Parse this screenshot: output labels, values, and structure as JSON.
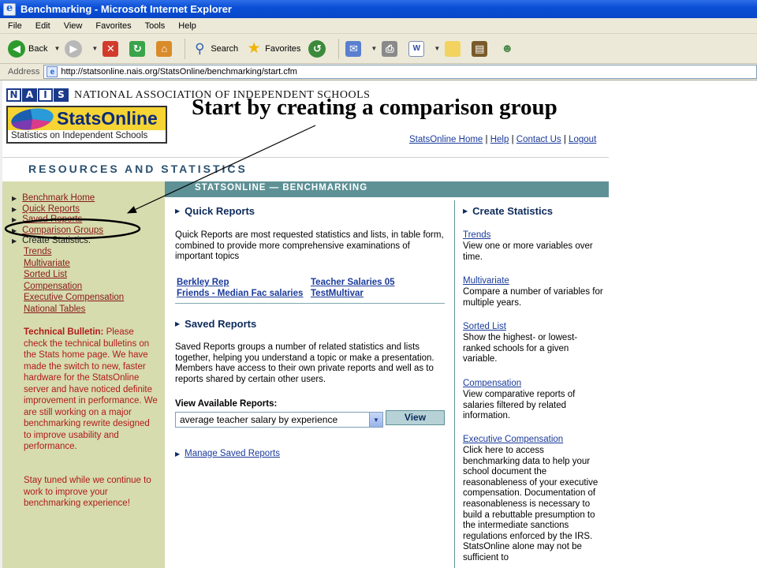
{
  "window": {
    "title": "Benchmarking - Microsoft Internet Explorer"
  },
  "menu": [
    "File",
    "Edit",
    "View",
    "Favorites",
    "Tools",
    "Help"
  ],
  "toolbar": {
    "back": "Back",
    "search": "Search",
    "favorites": "Favorites"
  },
  "address": {
    "label": "Address",
    "url": "http://statsonline.nais.org/StatsOnline/benchmarking/start.cfm"
  },
  "header": {
    "org_name": "NATIONAL ASSOCIATION OF INDEPENDENT SCHOOLS",
    "nais_letters": [
      "N",
      "A",
      "I",
      "S"
    ],
    "stats_name": "StatsOnline",
    "stats_sub": "Statistics on Independent Schools",
    "annotation": "Start by creating a comparison group",
    "links": [
      "StatsOnline Home",
      "Help",
      "Contact Us",
      "Logout"
    ],
    "link_sep": "|",
    "section_title": "RESOURCES AND STATISTICS"
  },
  "sidebar": {
    "items": [
      {
        "label": "Benchmark Home"
      },
      {
        "label": "Quick Reports"
      },
      {
        "label": "Saved Reports"
      },
      {
        "label": "Comparison Groups"
      },
      {
        "label": "Create Statistics:"
      }
    ],
    "subitems": [
      "Trends",
      "Multivariate",
      "Sorted List",
      "Compensation",
      "Executive Compensation",
      "National Tables"
    ],
    "bulletin_title": "Technical Bulletin:",
    "bulletin_text": "Please check the technical bulletins on the Stats home page. We have made the switch to new, faster hardware for the StatsOnline server and have noticed definite improvement in performance. We are still working on a major benchmarking rewrite designed to improve usability and performance.",
    "stay_tuned": "Stay tuned while we continue to work to improve your benchmarking experience!"
  },
  "main": {
    "banner": "STATSONLINE — BENCHMARKING",
    "quick_reports": {
      "title": "Quick Reports",
      "description": "Quick Reports are most requested statistics and lists, in table form, combined to provide more comprehensive examinations of important topics",
      "links": [
        "Berkley Rep",
        "Teacher Salaries 05",
        "Friends - Median Fac salaries",
        "TestMultivar"
      ]
    },
    "saved_reports": {
      "title": "Saved Reports",
      "description": "Saved Reports groups a number of related statistics and lists together, helping you understand a topic or make a presentation. Members have access to their own private reports and well as to reports shared by certain other users.",
      "view_label": "View Available Reports:",
      "selected": "average teacher salary by experience",
      "view_button": "View",
      "manage_link": "Manage Saved Reports"
    },
    "create_statistics": {
      "title": "Create Statistics",
      "items": [
        {
          "link": "Trends",
          "desc": "View one or more variables over time."
        },
        {
          "link": "Multivariate",
          "desc": "Compare a number of variables for multiple years."
        },
        {
          "link": "Sorted List",
          "desc": "Show the highest- or lowest-ranked schools for a given variable."
        },
        {
          "link": "Compensation",
          "desc": "View comparative reports of salaries filtered by related information."
        },
        {
          "link": "Executive Compensation",
          "desc": "Click here to access benchmarking data to help your school document the reasonableness of your executive compensation. Documentation of reasonableness is necessary to build a rebuttable presumption to the intermediate sanctions regulations enforced by the IRS. StatsOnline alone may not be sufficient to"
        }
      ]
    }
  },
  "colors": {
    "sidebar_bg": "#d6dcae",
    "teal": "#5e9196",
    "link_blue": "#1a3a9a",
    "sidebar_link": "#8a1a1a",
    "bulletin_red": "#b01a1a"
  }
}
